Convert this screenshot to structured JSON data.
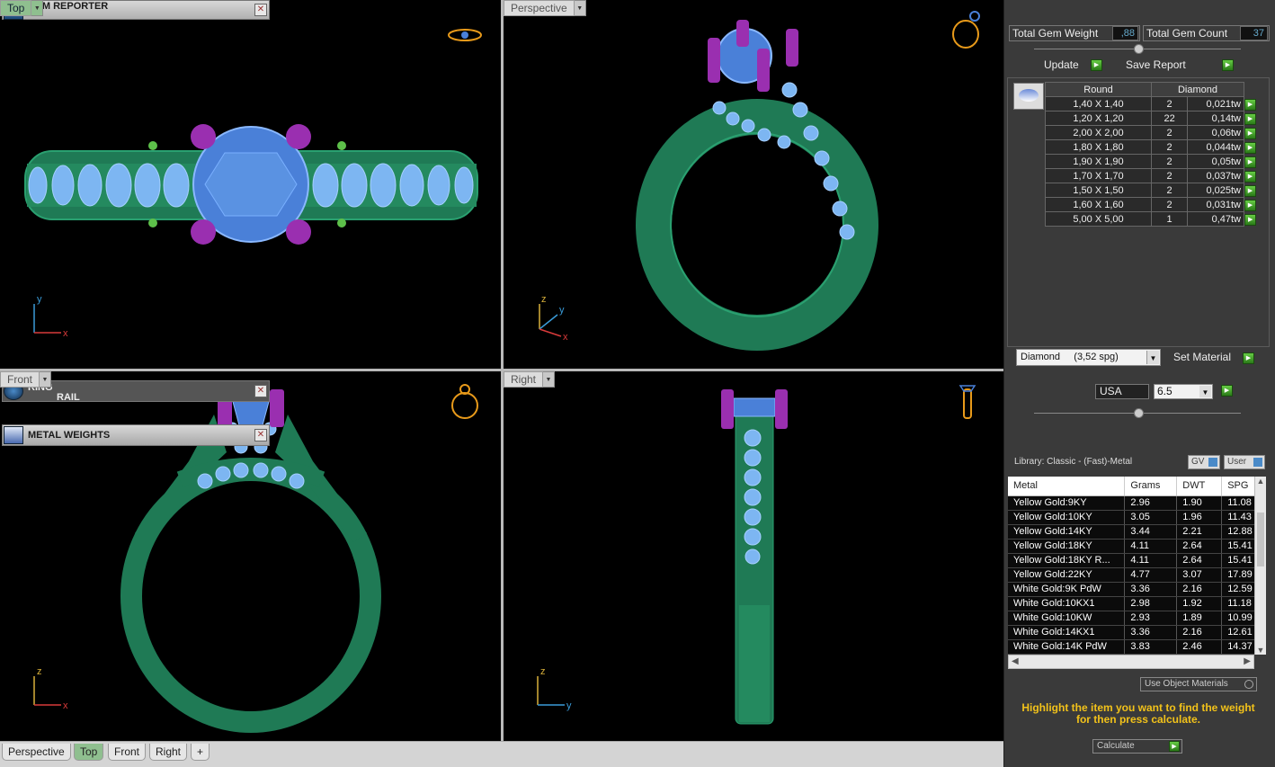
{
  "viewports": {
    "top": {
      "label": "Top",
      "axis_a": "y",
      "axis_b": "x"
    },
    "perspective": {
      "label": "Perspective",
      "axis_a": "z",
      "axis_b": "y",
      "axis_c": "x"
    },
    "front": {
      "label": "Front",
      "axis_a": "z",
      "axis_b": "x"
    },
    "right": {
      "label": "Right",
      "axis_a": "z",
      "axis_b": "y"
    }
  },
  "tabs": [
    "Perspective",
    "Top",
    "Front",
    "Right",
    "+"
  ],
  "active_tab": "Top",
  "gem_reporter": {
    "title": "GEM REPORTER",
    "total_weight_label": "Total Gem Weight",
    "total_weight_value": ",88",
    "total_count_label": "Total Gem Count",
    "total_count_value": "37",
    "update_label": "Update",
    "save_report_label": "Save Report",
    "col_shape": "Round",
    "col_material": "Diamond",
    "rows": [
      {
        "size": "1,40 X 1,40",
        "count": "2",
        "weight": "0,021tw"
      },
      {
        "size": "1,20 X 1,20",
        "count": "22",
        "weight": "0,14tw"
      },
      {
        "size": "2,00 X 2,00",
        "count": "2",
        "weight": "0,06tw"
      },
      {
        "size": "1,80 X 1,80",
        "count": "2",
        "weight": "0,044tw"
      },
      {
        "size": "1,90 X 1,90",
        "count": "2",
        "weight": "0,05tw"
      },
      {
        "size": "1,70 X 1,70",
        "count": "2",
        "weight": "0,037tw"
      },
      {
        "size": "1,50 X 1,50",
        "count": "2",
        "weight": "0,025tw"
      },
      {
        "size": "1,60 X 1,60",
        "count": "2",
        "weight": "0,031tw"
      },
      {
        "size": "5,00 X 5,00",
        "count": "1",
        "weight": "0,47tw"
      }
    ],
    "material_select": "Diamond     (3,52 spg)",
    "set_material_label": "Set Material"
  },
  "ring_rail": {
    "title_line1": "RING",
    "title_line2": "RAIL",
    "standard": "USA",
    "size": "6.5"
  },
  "metal_weights": {
    "title": "METAL WEIGHTS",
    "library": "Library: Classic - (Fast)-Metal",
    "gv_label": "GV",
    "user_label": "User",
    "columns": [
      "Metal",
      "Grams",
      "DWT",
      "SPG"
    ],
    "rows": [
      [
        "Yellow Gold:9KY",
        "2.96",
        "1.90",
        "11.08"
      ],
      [
        "Yellow Gold:10KY",
        "3.05",
        "1.96",
        "11.43"
      ],
      [
        "Yellow Gold:14KY",
        "3.44",
        "2.21",
        "12.88"
      ],
      [
        "Yellow Gold:18KY",
        "4.11",
        "2.64",
        "15.41"
      ],
      [
        "Yellow Gold:18KY R...",
        "4.11",
        "2.64",
        "15.41"
      ],
      [
        "Yellow Gold:22KY",
        "4.77",
        "3.07",
        "17.89"
      ],
      [
        "White Gold:9K PdW",
        "3.36",
        "2.16",
        "12.59"
      ],
      [
        "White Gold:10KX1",
        "2.98",
        "1.92",
        "11.18"
      ],
      [
        "White Gold:10KW",
        "2.93",
        "1.89",
        "10.99"
      ],
      [
        "White Gold:14KX1",
        "3.36",
        "2.16",
        "12.61"
      ],
      [
        "White Gold:14K PdW",
        "3.83",
        "2.46",
        "14.37"
      ]
    ],
    "use_object_label": "Use Object Materials",
    "hint": "Highlight the item you want to find the weight for then press calculate.",
    "calculate_label": "Calculate"
  },
  "colors": {
    "metal": "#1f7a55",
    "gem": "#6aa8f0",
    "prong": "#9a2fb0",
    "accent": "#8fbf8f",
    "hint": "#f2c21a"
  }
}
